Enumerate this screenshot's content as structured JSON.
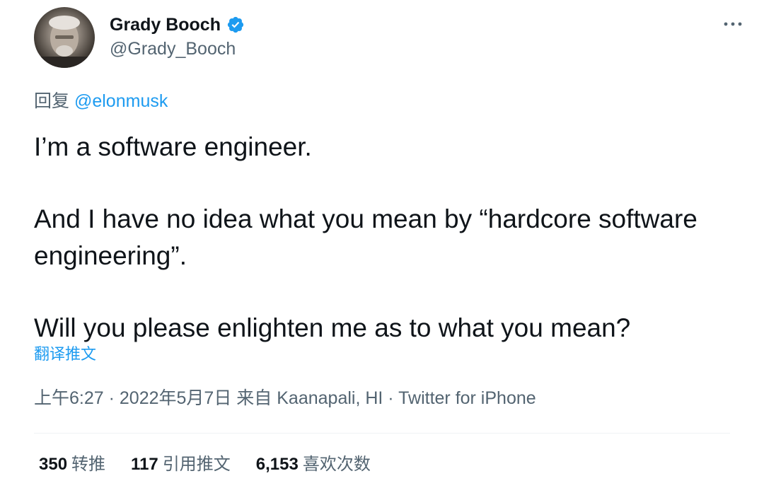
{
  "author": {
    "display_name": "Grady Booch",
    "handle": "@Grady_Booch",
    "verified": true,
    "avatar_icon": "avatar-photo"
  },
  "reply": {
    "prefix": "回复",
    "target": "@elonmusk"
  },
  "tweet": {
    "paragraphs": [
      "I’m a software engineer.",
      "And I have no idea what you mean by “hardcore software engineering”.",
      "Will you please enlighten me as to what you mean?"
    ]
  },
  "translate_label": "翻译推文",
  "meta": {
    "time": "上午6:27",
    "date": "2022年5月7日",
    "location_prefix": "来自",
    "location": "Kaanapali, HI",
    "source": "Twitter for iPhone",
    "separator": " · "
  },
  "stats": {
    "retweets": {
      "count": "350",
      "label": "转推"
    },
    "quotes": {
      "count": "117",
      "label": "引用推文"
    },
    "likes": {
      "count": "6,153",
      "label": "喜欢次数"
    }
  },
  "colors": {
    "accent": "#1d9bf0",
    "text": "#0f1419",
    "secondary": "#536471"
  }
}
